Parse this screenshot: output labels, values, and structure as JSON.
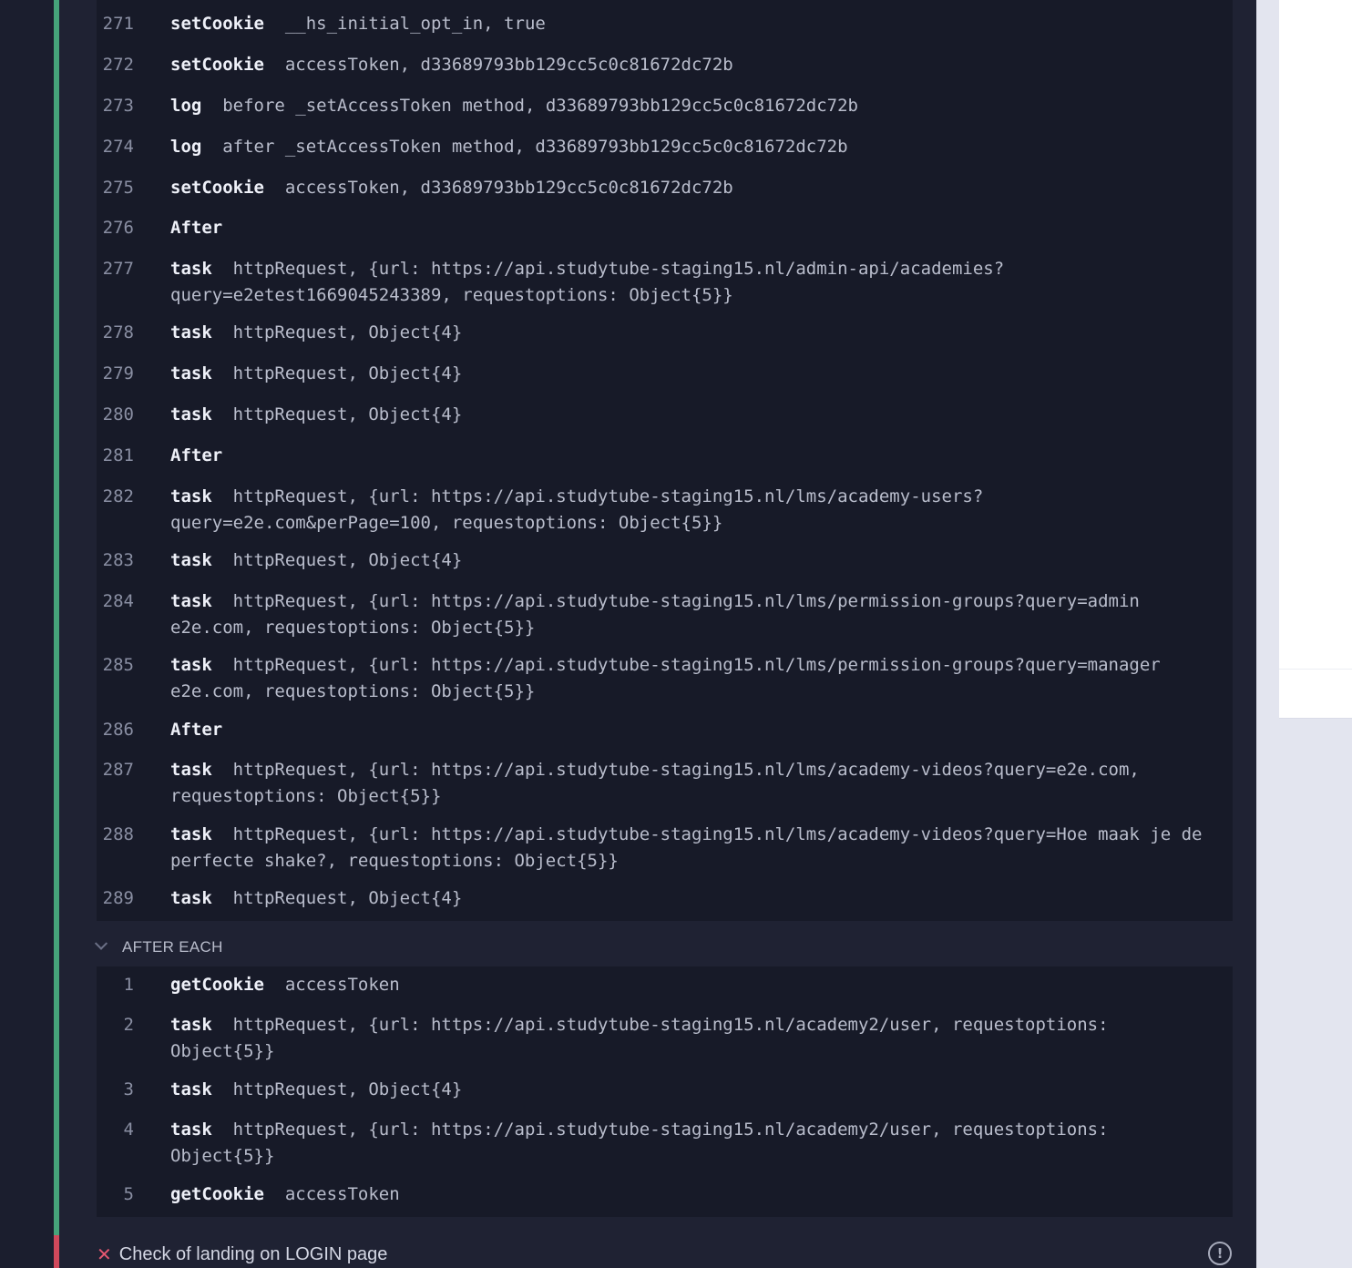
{
  "test_log": {
    "rows": [
      {
        "num": "271",
        "cmd": "setCookie",
        "msg": "__hs_initial_opt_in, true"
      },
      {
        "num": "272",
        "cmd": "setCookie",
        "msg": "accessToken, d33689793bb129cc5c0c81672dc72b"
      },
      {
        "num": "273",
        "cmd": "log",
        "msg": "before _setAccessToken method, d33689793bb129cc5c0c81672dc72b"
      },
      {
        "num": "274",
        "cmd": "log",
        "msg": "after _setAccessToken method, d33689793bb129cc5c0c81672dc72b"
      },
      {
        "num": "275",
        "cmd": "setCookie",
        "msg": "accessToken, d33689793bb129cc5c0c81672dc72b"
      },
      {
        "num": "276",
        "cmd": "After",
        "msg": ""
      },
      {
        "num": "277",
        "cmd": "task",
        "msg": "httpRequest, {url: https://api.studytube-staging15.nl/admin-api/academies?\nquery=e2etest1669045243389, requestoptions: Object{5}}"
      },
      {
        "num": "278",
        "cmd": "task",
        "msg": "httpRequest, Object{4}"
      },
      {
        "num": "279",
        "cmd": "task",
        "msg": "httpRequest, Object{4}"
      },
      {
        "num": "280",
        "cmd": "task",
        "msg": "httpRequest, Object{4}"
      },
      {
        "num": "281",
        "cmd": "After",
        "msg": ""
      },
      {
        "num": "282",
        "cmd": "task",
        "msg": "httpRequest, {url: https://api.studytube-staging15.nl/lms/academy-users?\nquery=e2e.com&perPage=100, requestoptions: Object{5}}"
      },
      {
        "num": "283",
        "cmd": "task",
        "msg": "httpRequest, Object{4}"
      },
      {
        "num": "284",
        "cmd": "task",
        "msg": "httpRequest, {url: https://api.studytube-staging15.nl/lms/permission-groups?query=admin\ne2e.com, requestoptions: Object{5}}"
      },
      {
        "num": "285",
        "cmd": "task",
        "msg": "httpRequest, {url: https://api.studytube-staging15.nl/lms/permission-groups?query=manager\ne2e.com, requestoptions: Object{5}}"
      },
      {
        "num": "286",
        "cmd": "After",
        "msg": ""
      },
      {
        "num": "287",
        "cmd": "task",
        "msg": "httpRequest, {url: https://api.studytube-staging15.nl/lms/academy-videos?query=e2e.com,\nrequestoptions: Object{5}}"
      },
      {
        "num": "288",
        "cmd": "task",
        "msg": "httpRequest, {url: https://api.studytube-staging15.nl/lms/academy-videos?query=Hoe maak je de\nperfecte shake?, requestoptions: Object{5}}"
      },
      {
        "num": "289",
        "cmd": "task",
        "msg": "httpRequest, Object{4}"
      }
    ]
  },
  "after_each": {
    "label": "AFTER EACH",
    "rows": [
      {
        "num": "1",
        "cmd": "getCookie",
        "msg": "accessToken"
      },
      {
        "num": "2",
        "cmd": "task",
        "msg": "httpRequest, {url: https://api.studytube-staging15.nl/academy2/user, requestoptions:\nObject{5}}"
      },
      {
        "num": "3",
        "cmd": "task",
        "msg": "httpRequest, Object{4}"
      },
      {
        "num": "4",
        "cmd": "task",
        "msg": "httpRequest, {url: https://api.studytube-staging15.nl/academy2/user, requestoptions:\nObject{5}}"
      },
      {
        "num": "5",
        "cmd": "getCookie",
        "msg": "accessToken"
      }
    ]
  },
  "next_test": {
    "title": "Check of landing on LOGIN page",
    "status_icon": "x-icon",
    "alert_symbol": "!"
  },
  "colors": {
    "pass": "#46a37a",
    "fail": "#d0485b"
  }
}
